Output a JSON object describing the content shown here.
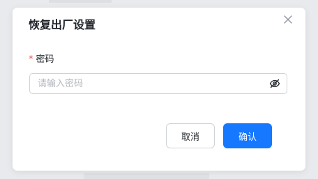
{
  "dialog": {
    "title": "恢复出厂设置",
    "close_icon": "close-icon",
    "password": {
      "required_mark": "*",
      "label": "密码",
      "placeholder": "请输入密码",
      "value": "",
      "visibility_icon": "eye-off-icon"
    },
    "buttons": {
      "cancel_label": "取消",
      "confirm_label": "确认"
    }
  },
  "colors": {
    "primary": "#1677ff",
    "required": "#f54a45",
    "overlay_bg": "#e9eaed",
    "border": "#d0d3d6",
    "text": "#1f2329",
    "placeholder": "#b4b8bf"
  }
}
